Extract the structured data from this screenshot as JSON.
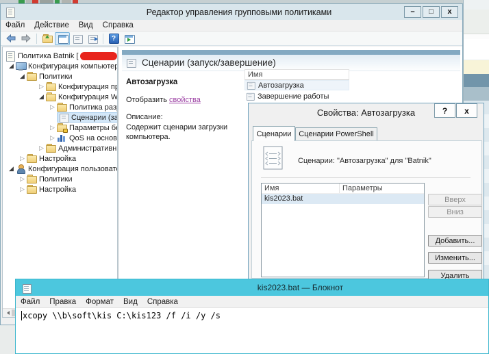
{
  "colors": {
    "editor_titlebar": "#d9e6ec",
    "notepad_titlebar": "#4cc7de",
    "pane_header_band": "#83a9c2",
    "tree_selection": "#d3e7f8",
    "dialog_row_selection": "#dce9f4",
    "link": "#9b3fa3",
    "redaction": "#e8251d",
    "bg_bands": [
      "#ecefec",
      "#ffffff",
      "#f8f4d8",
      "#7295aa",
      "#a9bfca",
      "#e0eaef"
    ]
  },
  "editor": {
    "title": "Редактор управления групповыми политиками",
    "controls": {
      "minimize": "–",
      "maximize": "□",
      "close": "x"
    },
    "menu": {
      "items": [
        "Файл",
        "Действие",
        "Вид",
        "Справка"
      ]
    },
    "toolbar": {
      "icons": [
        "back-arrow",
        "forward-arrow",
        "folder-up",
        "console-window",
        "document-window",
        "export-list",
        "help",
        "show-window"
      ],
      "help_glyph": "?"
    },
    "tree": [
      {
        "label": "Политика Batnik ["
      },
      {
        "label": "Конфигурация компьютер"
      },
      {
        "label": "Политики"
      },
      {
        "label": "Конфигурация прог"
      },
      {
        "label": "Конфигурация Winc"
      },
      {
        "label": "Политика разреш"
      },
      {
        "label": "Сценарии (запус"
      },
      {
        "label": "Параметры безо"
      },
      {
        "label": "QoS на основе п"
      },
      {
        "label": "Административные"
      },
      {
        "label": "Настройка"
      },
      {
        "label": "Конфигурация пользовате"
      },
      {
        "label": "Политики"
      },
      {
        "label": "Настройка"
      }
    ],
    "pane": {
      "header": "Сценарии (запуск/завершение)",
      "item_title": "Автозагрузка",
      "display_prefix": "Отобразить ",
      "properties_link": "свойства",
      "description_label": "Описание:",
      "description": "Содержит сценарии загрузки компьютера.",
      "list_header": "Имя",
      "list_items": [
        "Автозагрузка",
        "Завершение работы"
      ]
    }
  },
  "dialog": {
    "title": "Свойства: Автозагрузка",
    "help": "?",
    "close": "x",
    "tabs": [
      "Сценарии",
      "Сценарии PowerShell"
    ],
    "caption": "Сценарии: \"Автозагрузка\" для \"Batnik\"",
    "columns": [
      "Имя",
      "Параметры"
    ],
    "rows": [
      {
        "name": "kis2023.bat"
      }
    ],
    "buttons": [
      "Вверх",
      "Вниз",
      "Добавить...",
      "Изменить...",
      "Удалить"
    ]
  },
  "notepad": {
    "title": "kis2023.bat — Блокнот",
    "menu": [
      "Файл",
      "Правка",
      "Формат",
      "Вид",
      "Справка"
    ],
    "text": "xcopy \\\\b\\soft\\kis C:\\kis123 /f /i /y /s"
  }
}
